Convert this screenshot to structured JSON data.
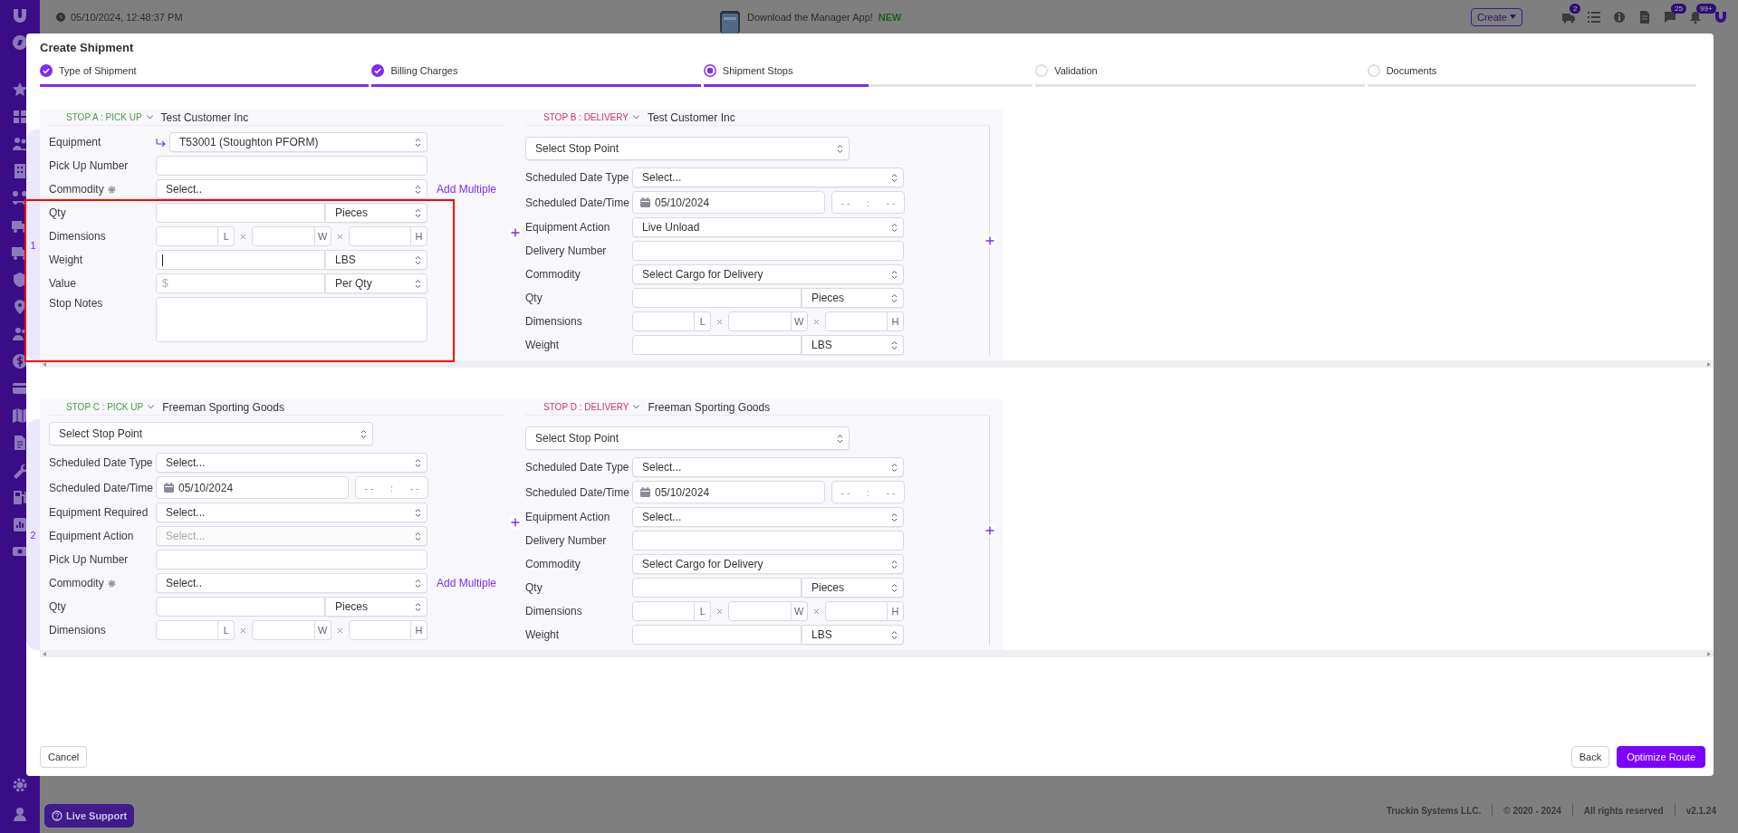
{
  "top_bar": {
    "datetime": "05/10/2024, 12:48:37 PM",
    "promo": "Download the Manager App!",
    "promo_badge": "NEW",
    "create_button": "Create",
    "icons": [
      {
        "kind": "truck",
        "badge": "2"
      },
      {
        "kind": "list"
      },
      {
        "kind": "info"
      },
      {
        "kind": "document"
      },
      {
        "kind": "chat",
        "badge": "25"
      },
      {
        "kind": "bell",
        "badge": "99+"
      },
      {
        "kind": "logo"
      }
    ]
  },
  "modal": {
    "title": "Create Shipment",
    "steps": [
      {
        "label": "Type of Shipment",
        "checked": true,
        "selected": false,
        "level": 1
      },
      {
        "label": "Billing Charges",
        "checked": true,
        "selected": false,
        "level": 1
      },
      {
        "label": "Shipment Stops",
        "checked": false,
        "selected": true,
        "level": 0.5
      },
      {
        "label": "Validation",
        "checked": false,
        "selected": false,
        "level": 0
      },
      {
        "label": "Documents",
        "checked": false,
        "selected": false,
        "level": 0
      }
    ],
    "stop_rows": [
      {
        "number": "1",
        "stops": [
          {
            "label": "STOP A : PICK UP",
            "color": "#4a9a46",
            "customer": "Test Customer Inc",
            "fields": [
              {
                "kind": "select",
                "label": "Equipment",
                "value": "T53001 (Stoughton PFORM)",
                "linked": true,
                "disabled": false
              },
              {
                "kind": "text",
                "label": "Pick Up Number"
              },
              {
                "kind": "select",
                "label": "Commodity",
                "value": "Select..",
                "settings": true,
                "link": "Add Multiple",
                "disabled": false
              },
              {
                "kind": "unit",
                "label": "Qty",
                "unit": "Pieces",
                "focused": false
              },
              {
                "kind": "dims",
                "label": "Dimensions",
                "units": [
                  "L",
                  "W",
                  "H"
                ]
              },
              {
                "kind": "unit",
                "label": "Weight",
                "unit": "LBS",
                "focused": true
              },
              {
                "kind": "unit",
                "label": "Value",
                "placeholder": "$",
                "unit": "Per Qty",
                "focused": false
              },
              {
                "kind": "textarea",
                "label": "Stop Notes"
              }
            ]
          },
          {
            "label": "STOP B : DELIVERY",
            "color": "#c8385f",
            "customer": "Test Customer Inc",
            "fields": [
              {
                "kind": "stop_point",
                "value": "Select Stop Point"
              },
              {
                "kind": "select",
                "label": "Scheduled Date Type",
                "value": "Select...",
                "disabled": false
              },
              {
                "kind": "datetime",
                "label": "Scheduled Date/Time",
                "date": "05/10/2024",
                "hour": "- -",
                "separator": ":",
                "minute": "- -"
              },
              {
                "kind": "select",
                "label": "Equipment Action",
                "value": "Live Unload",
                "disabled": false
              },
              {
                "kind": "text",
                "label": "Delivery Number"
              },
              {
                "kind": "select",
                "label": "Commodity",
                "value": "Select Cargo for Delivery",
                "disabled": false
              },
              {
                "kind": "unit",
                "label": "Qty",
                "unit": "Pieces",
                "focused": false
              },
              {
                "kind": "dims",
                "label": "Dimensions",
                "units": [
                  "L",
                  "W",
                  "H"
                ]
              },
              {
                "kind": "unit",
                "label": "Weight",
                "unit": "LBS",
                "focused": false
              }
            ]
          }
        ]
      },
      {
        "number": "2",
        "stops": [
          {
            "label": "STOP C : PICK UP",
            "color": "#4a9a46",
            "customer": "Freeman Sporting Goods",
            "fields": [
              {
                "kind": "stop_point",
                "value": "Select Stop Point"
              },
              {
                "kind": "select",
                "label": "Scheduled Date Type",
                "value": "Select...",
                "disabled": false
              },
              {
                "kind": "datetime",
                "label": "Scheduled Date/Time",
                "date": "05/10/2024",
                "hour": "- -",
                "separator": ":",
                "minute": "- -"
              },
              {
                "kind": "select",
                "label": "Equipment Required",
                "value": "Select...",
                "disabled": false
              },
              {
                "kind": "select",
                "label": "Equipment Action",
                "value": "Select...",
                "disabled": true
              },
              {
                "kind": "text",
                "label": "Pick Up Number"
              },
              {
                "kind": "select",
                "label": "Commodity",
                "value": "Select..",
                "settings": true,
                "link": "Add Multiple",
                "disabled": false
              },
              {
                "kind": "unit",
                "label": "Qty",
                "unit": "Pieces",
                "focused": false
              },
              {
                "kind": "dims",
                "label": "Dimensions",
                "units": [
                  "L",
                  "W",
                  "H"
                ]
              }
            ]
          },
          {
            "label": "STOP D : DELIVERY",
            "color": "#c8385f",
            "customer": "Freeman Sporting Goods",
            "fields": [
              {
                "kind": "stop_point",
                "value": "Select Stop Point"
              },
              {
                "kind": "select",
                "label": "Scheduled Date Type",
                "value": "Select...",
                "disabled": false
              },
              {
                "kind": "datetime",
                "label": "Scheduled Date/Time",
                "date": "05/10/2024",
                "hour": "- -",
                "separator": ":",
                "minute": "- -"
              },
              {
                "kind": "select",
                "label": "Equipment Action",
                "value": "Select...",
                "disabled": false
              },
              {
                "kind": "text",
                "label": "Delivery Number"
              },
              {
                "kind": "select",
                "label": "Commodity",
                "value": "Select Cargo for Delivery",
                "disabled": false
              },
              {
                "kind": "unit",
                "label": "Qty",
                "unit": "Pieces",
                "focused": false
              },
              {
                "kind": "dims",
                "label": "Dimensions",
                "units": [
                  "L",
                  "W",
                  "H"
                ]
              },
              {
                "kind": "unit",
                "label": "Weight",
                "unit": "LBS",
                "focused": false
              }
            ]
          }
        ]
      }
    ],
    "buttons": {
      "cancel": "Cancel",
      "back": "Back",
      "primary": "Optimize Route"
    }
  },
  "footer": {
    "company": "Truckin Systems LLC.",
    "copyright": "© 2020 - 2024",
    "rights": "All rights reserved",
    "version": "v2.1.24"
  },
  "live_support": "Live Support"
}
